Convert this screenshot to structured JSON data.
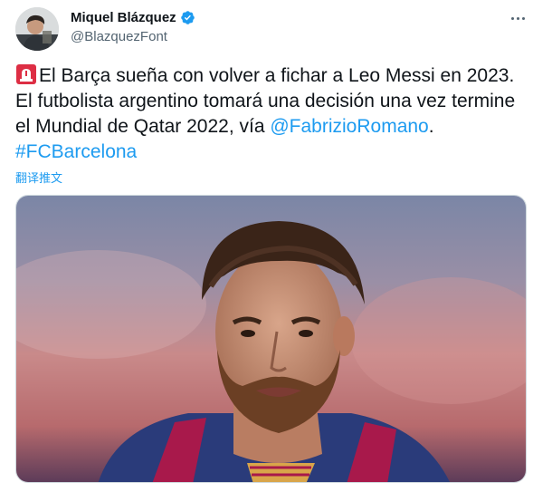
{
  "author": {
    "display_name": "Miquel Blázquez",
    "handle": "@BlazquezFont",
    "verified": true,
    "avatar_icon": "profile-photo"
  },
  "more_icon": "more-horizontal-icon",
  "tweet": {
    "emoji": "rotating-light-emoji",
    "text_part1": "El Barça sueña con volver a fichar a Leo Messi en 2023. El futbolista argentino tomará una decisión una vez termine el Mundial de Qatar 2022, vía ",
    "mention": "@FabrizioRomano",
    "text_part2": ". ",
    "hashtag": "#FCBarcelona"
  },
  "translate_label": "翻译推文",
  "colors": {
    "link": "#1d9bf0",
    "text": "#0f1419",
    "secondary": "#536471",
    "verified": "#1d9bf0"
  },
  "media": {
    "type": "photo",
    "subject": "portrait-photo"
  }
}
